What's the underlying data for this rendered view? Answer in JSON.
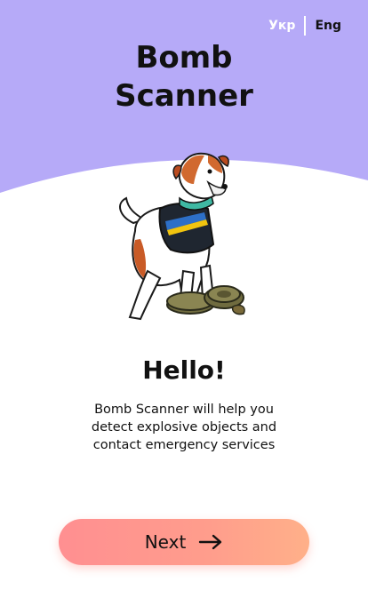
{
  "colors": {
    "hero": "#b6aaf8",
    "button_start": "#ff8f91",
    "button_end": "#ffb089"
  },
  "language": {
    "ukr": "Укр",
    "eng": "Eng",
    "selected": "Eng"
  },
  "header": {
    "title_line1": "Bomb",
    "title_line2": "Scanner"
  },
  "illustration": {
    "icon": "dog-with-vest-icon"
  },
  "content": {
    "greeting": "Hello!",
    "description_line1": "Bomb Scanner will help you",
    "description_line2": "detect explosive objects and",
    "description_line3": "contact emergency services"
  },
  "actions": {
    "next_label": "Next",
    "next_icon": "arrow-right-icon"
  }
}
